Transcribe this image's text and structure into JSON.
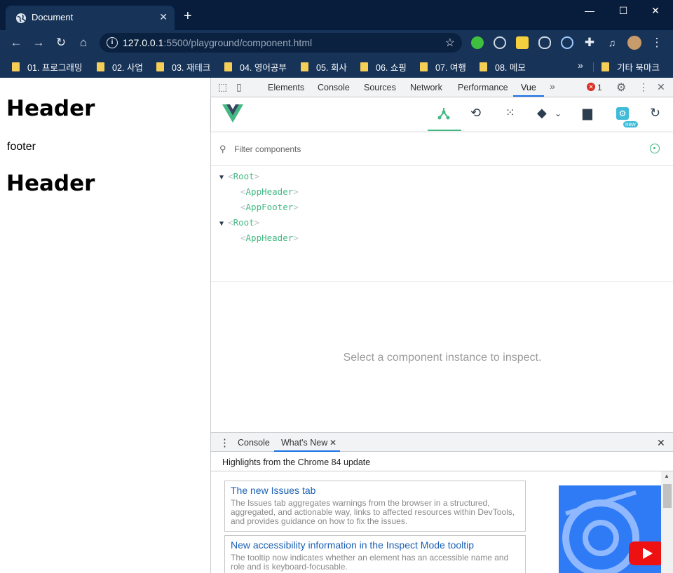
{
  "browser": {
    "tab_title": "Document",
    "tab_close": "✕",
    "new_tab": "+",
    "window_controls": {
      "minimize": "—",
      "maximize": "☐",
      "close": "✕"
    },
    "url_host": "127.0.0.1",
    "url_rest": ":5500/playground/component.html",
    "bookmarks": [
      "01. 프로그래밍",
      "02. 사업",
      "03. 재테크",
      "04. 영어공부",
      "05. 회사",
      "06. 쇼핑",
      "07. 여행",
      "08. 메모"
    ],
    "bookmarks_more": "»",
    "other_bookmarks": "기타 북마크"
  },
  "page": {
    "header1": "Header",
    "footer": "footer",
    "header2": "Header"
  },
  "devtools": {
    "tabs": [
      "Elements",
      "Console",
      "Sources",
      "Network",
      "Performance",
      "Vue"
    ],
    "more_tabs": "»",
    "error_count": "1",
    "vue": {
      "filter_placeholder": "Filter components",
      "tree": [
        {
          "label": "Root",
          "expanded": true,
          "depth": 0
        },
        {
          "label": "AppHeader",
          "depth": 1
        },
        {
          "label": "AppFooter",
          "depth": 1
        },
        {
          "label": "Root",
          "expanded": true,
          "depth": 0
        },
        {
          "label": "AppHeader",
          "depth": 1
        }
      ],
      "inspect_message": "Select a component instance to inspect.",
      "new_badge": "new",
      "accent_color": "#42b983"
    },
    "drawer": {
      "tabs": [
        "Console",
        "What's New"
      ],
      "tab_close": "✕",
      "highlights": "Highlights from the Chrome 84 update",
      "cards": [
        {
          "title": "The new Issues tab",
          "body": "The Issues tab aggregates warnings from the browser in a structured, aggregated, and actionable way, links to affected resources within DevTools, and provides guidance on how to fix the issues."
        },
        {
          "title": "New accessibility information in the Inspect Mode tooltip",
          "body": "The tooltip now indicates whether an element has an accessible name and role and is keyboard-focusable."
        }
      ]
    }
  }
}
